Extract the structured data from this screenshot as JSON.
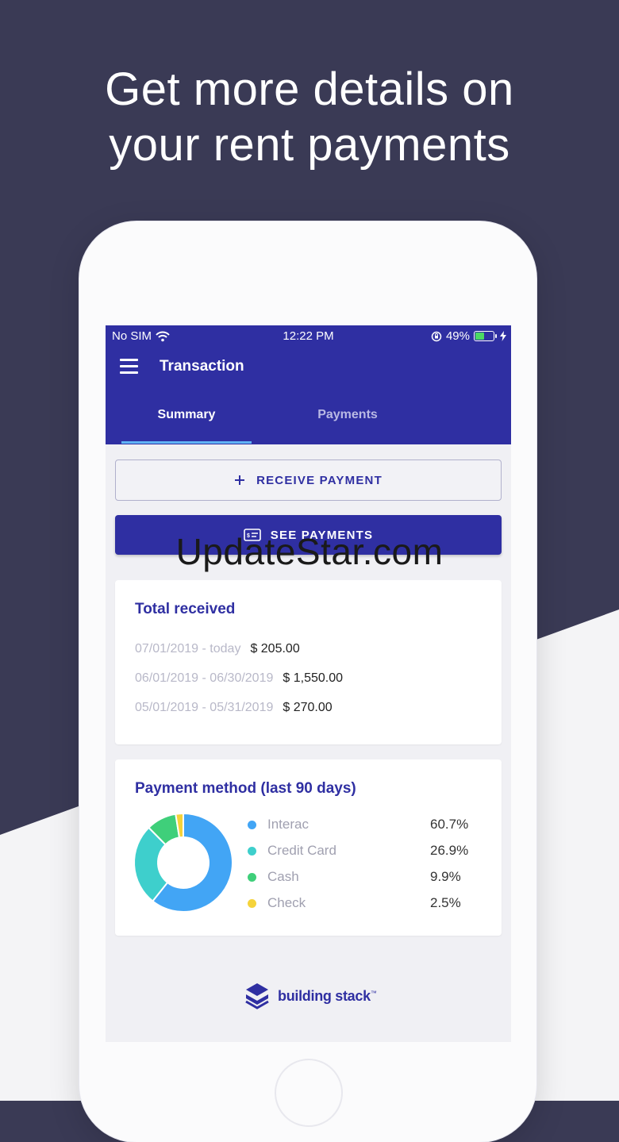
{
  "headline": {
    "line1": "Get more details on",
    "line2": "your rent payments"
  },
  "status_bar": {
    "carrier": "No SIM",
    "time": "12:22 PM",
    "battery": "49%"
  },
  "app_bar": {
    "title": "Transaction"
  },
  "tabs": [
    {
      "label": "Summary",
      "active": true
    },
    {
      "label": "Payments",
      "active": false
    }
  ],
  "actions": {
    "receive_payment": "RECEIVE PAYMENT",
    "see_payments": "SEE PAYMENTS"
  },
  "total_received": {
    "title": "Total received",
    "rows": [
      {
        "range": "07/01/2019 - today",
        "amount": "$ 205.00"
      },
      {
        "range": "06/01/2019 - 06/30/2019",
        "amount": "$ 1,550.00"
      },
      {
        "range": "05/01/2019 - 05/31/2019",
        "amount": "$ 270.00"
      }
    ]
  },
  "payment_method": {
    "title": "Payment method (last 90 days)",
    "items": [
      {
        "name": "Interac",
        "percent": "60.7%",
        "value": 60.7,
        "color": "#42a5f5"
      },
      {
        "name": "Credit Card",
        "percent": "26.9%",
        "value": 26.9,
        "color": "#3ecfcc"
      },
      {
        "name": "Cash",
        "percent": "9.9%",
        "value": 9.9,
        "color": "#3fcf7a"
      },
      {
        "name": "Check",
        "percent": "2.5%",
        "value": 2.5,
        "color": "#f5d33b"
      }
    ]
  },
  "brand": {
    "name": "building stack",
    "mark": "™"
  },
  "watermark": "UpdateStar.com",
  "colors": {
    "primary": "#2f2fa2",
    "background_dark": "#3a3a55",
    "tab_indicator": "#5fb3f5"
  },
  "icons": {
    "menu": "hamburger-icon",
    "wifi": "wifi-icon",
    "lock_rotation": "rotation-lock-icon",
    "battery": "battery-icon",
    "charging": "bolt-icon",
    "plus": "plus-icon",
    "card": "card-icon",
    "brand": "stack-logo-icon"
  }
}
